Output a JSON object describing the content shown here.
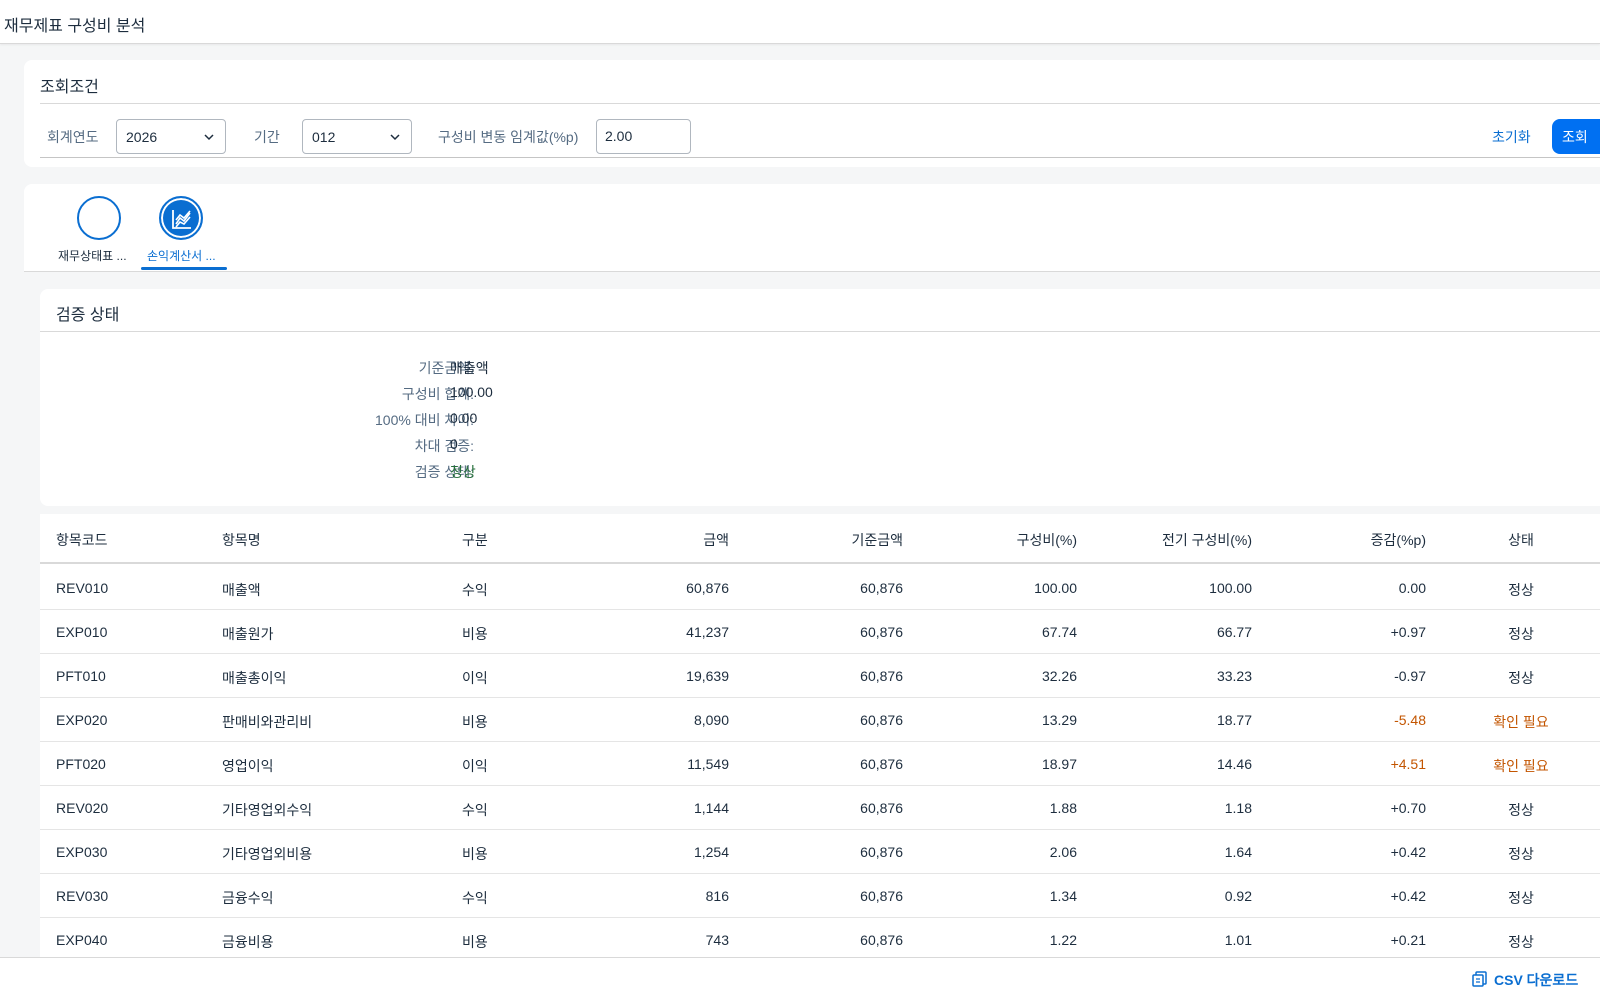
{
  "app": {
    "title": "재무제표 구성비 분석"
  },
  "filter": {
    "title": "조회조건",
    "fiscal_year_label": "회계연도",
    "fiscal_year_value": "2026",
    "period_label": "기간",
    "period_value": "012",
    "threshold_label": "구성비 변동 임계값(%p)",
    "threshold_value": "2.00",
    "reset_label": "초기화",
    "search_label": "조회"
  },
  "tabs": [
    {
      "label": "재무상태표 ...",
      "icon": "blank-circle-icon",
      "active": false
    },
    {
      "label": "손익계산서 ...",
      "icon": "line-chart-icon",
      "active": true
    }
  ],
  "validation": {
    "title": "검증 상태",
    "items": [
      {
        "key": "기준금액:",
        "value": "매출액"
      },
      {
        "key": "구성비 합계:",
        "value": "100.00"
      },
      {
        "key": "100% 대비 차이:",
        "value": "0.00"
      },
      {
        "key": "차대 검증:",
        "value": "0"
      },
      {
        "key": "검증 상태:",
        "value": "정상"
      }
    ]
  },
  "table": {
    "headers": [
      "항목코드",
      "항목명",
      "구분",
      "금액",
      "기준금액",
      "구성비(%)",
      "전기 구성비(%)",
      "증감(%p)",
      "상태"
    ],
    "rows": [
      [
        "REV010",
        "매출액",
        "수익",
        "60,876",
        "60,876",
        "100.00",
        "100.00",
        "0.00",
        "정상"
      ],
      [
        "EXP010",
        "매출원가",
        "비용",
        "41,237",
        "60,876",
        "67.74",
        "66.77",
        "+0.97",
        "정상"
      ],
      [
        "PFT010",
        "매출총이익",
        "이익",
        "19,639",
        "60,876",
        "32.26",
        "33.23",
        "-0.97",
        "정상"
      ],
      [
        "EXP020",
        "판매비와관리비",
        "비용",
        "8,090",
        "60,876",
        "13.29",
        "18.77",
        "-5.48",
        "확인 필요"
      ],
      [
        "PFT020",
        "영업이익",
        "이익",
        "11,549",
        "60,876",
        "18.97",
        "14.46",
        "+4.51",
        "확인 필요"
      ],
      [
        "REV020",
        "기타영업외수익",
        "수익",
        "1,144",
        "60,876",
        "1.88",
        "1.18",
        "+0.70",
        "정상"
      ],
      [
        "EXP030",
        "기타영업외비용",
        "비용",
        "1,254",
        "60,876",
        "2.06",
        "1.64",
        "+0.42",
        "정상"
      ],
      [
        "REV030",
        "금융수익",
        "수익",
        "816",
        "60,876",
        "1.34",
        "0.92",
        "+0.42",
        "정상"
      ],
      [
        "EXP040",
        "금융비용",
        "비용",
        "743",
        "60,876",
        "1.22",
        "1.01",
        "+0.21",
        "정상"
      ]
    ]
  },
  "footer": {
    "csv_label": "CSV 다운로드"
  },
  "colors": {
    "accent": "#0a6ed1",
    "button": "#0070f2",
    "ok": "#256f3a",
    "warning": "#c35500"
  }
}
